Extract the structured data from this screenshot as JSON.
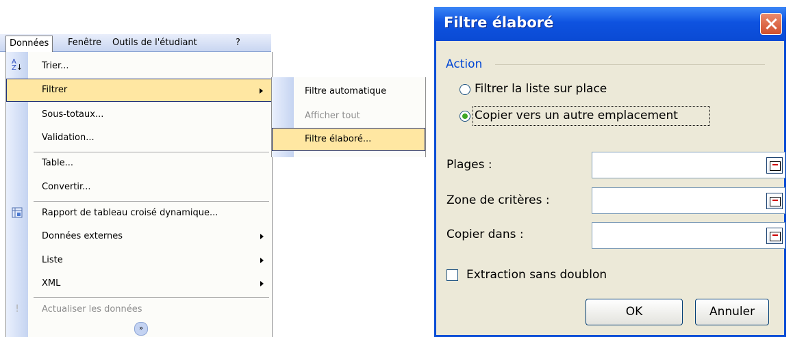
{
  "menubar": {
    "items": [
      "Données",
      "Fenêtre",
      "Outils de l'étudiant",
      "?"
    ]
  },
  "main_menu": {
    "items": [
      {
        "label": "Trier...",
        "icon": "sort-az-icon"
      },
      {
        "label": "Filtrer",
        "has_submenu": true,
        "highlighted": true
      },
      {
        "label": "Sous-totaux..."
      },
      {
        "label": "Validation..."
      },
      {
        "label": "Table..."
      },
      {
        "label": "Convertir..."
      },
      {
        "label": "Rapport de tableau croisé dynamique...",
        "icon": "pivot-table-icon"
      },
      {
        "label": "Données externes",
        "has_submenu": true
      },
      {
        "label": "Liste",
        "has_submenu": true
      },
      {
        "label": "XML",
        "has_submenu": true
      },
      {
        "label": "Actualiser les données",
        "icon": "refresh-icon",
        "disabled": true
      }
    ]
  },
  "sub_menu": {
    "items": [
      {
        "label": "Filtre automatique"
      },
      {
        "label": "Afficher tout",
        "disabled": true
      },
      {
        "label": "Filtre élaboré...",
        "highlighted": true
      }
    ]
  },
  "dialog": {
    "title": "Filtre élaboré",
    "group_title": "Action",
    "radio_in_place": "Filtrer la liste sur place",
    "radio_copy": "Copier vers un autre emplacement",
    "selected_action": "copy",
    "fields": {
      "plages": {
        "label": "Plages :",
        "value": ""
      },
      "criteres": {
        "label": "Zone de critères :",
        "value": ""
      },
      "copier": {
        "label": "Copier dans :",
        "value": ""
      }
    },
    "checkbox_unique": {
      "label": "Extraction sans doublon",
      "checked": false
    },
    "ok_label": "OK",
    "cancel_label": "Annuler"
  }
}
